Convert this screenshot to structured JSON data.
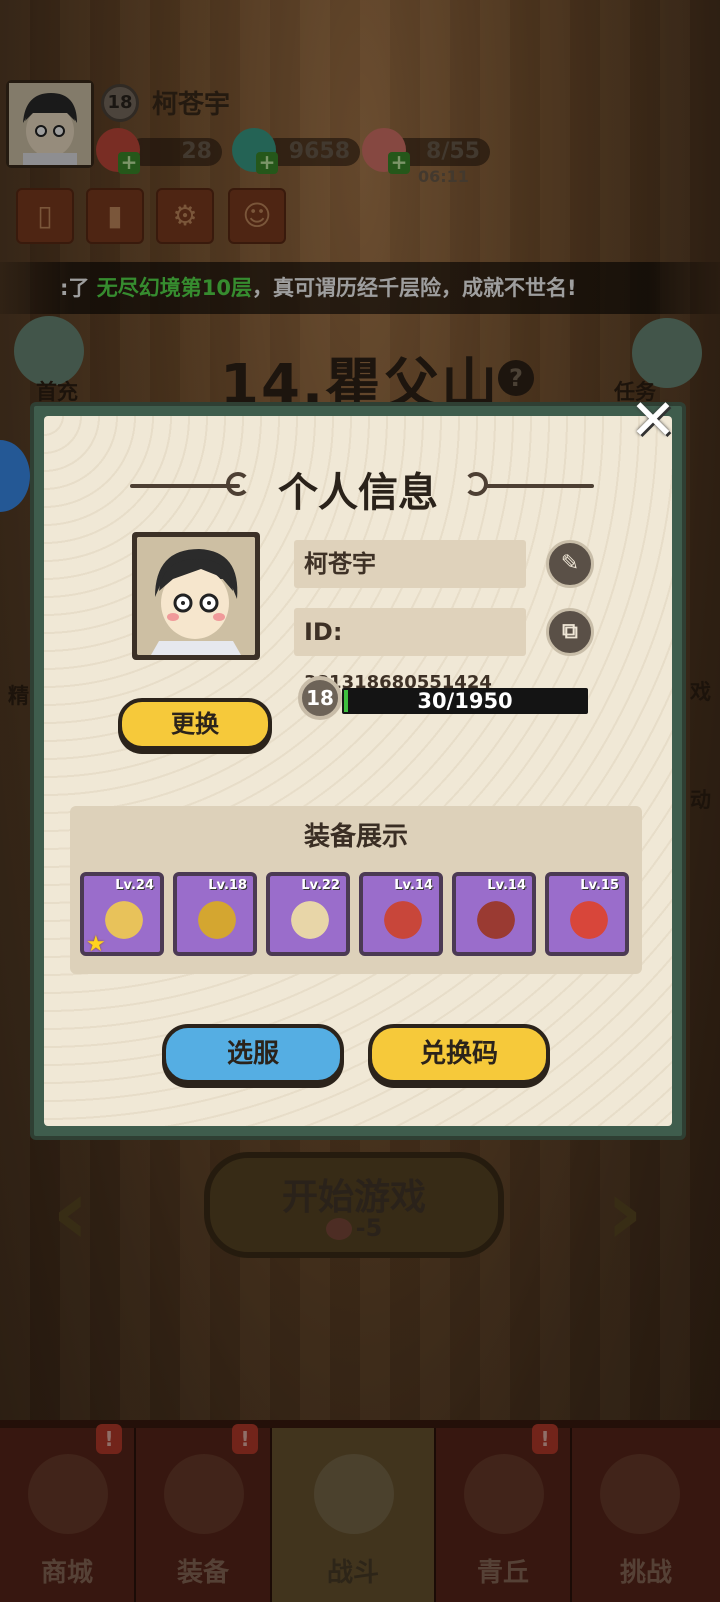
{
  "player": {
    "name": "柯苍宇",
    "level": "18"
  },
  "resources": {
    "gems": "28",
    "coins": "9658",
    "stamina": "8/55",
    "stamina_timer": "06:11"
  },
  "marquee": {
    "prefix": ":了 ",
    "highlight": "无尽幻境第10层",
    "suffix": "，真可谓历经千层险，成就不世名!"
  },
  "side": {
    "first_charge": "首充",
    "quest": "任务",
    "left_partial": "精",
    "right_partial_1": "戏",
    "right_partial_2": "动"
  },
  "stage": {
    "title": "14.瞿父山"
  },
  "modal": {
    "title": "个人信息",
    "name": "柯苍宇",
    "id_label": "ID:",
    "id_value": "381318680551424",
    "level": "18",
    "xp_text": "30/1950",
    "xp_fraction": 0.0154,
    "change_button": "更换",
    "equip_title": "装备展示",
    "equipment": [
      {
        "level": "Lv.24",
        "icon": "necklace-icon",
        "color": "#e8c25a",
        "starred": true
      },
      {
        "level": "Lv.18",
        "icon": "armor-icon",
        "color": "#d4a630",
        "starred": false
      },
      {
        "level": "Lv.22",
        "icon": "glove-icon",
        "color": "#e8d6a8",
        "starred": false
      },
      {
        "level": "Lv.14",
        "icon": "belt-icon",
        "color": "#c8463a",
        "starred": false
      },
      {
        "level": "Lv.14",
        "icon": "boots-icon",
        "color": "#9a3a32",
        "starred": false
      },
      {
        "level": "Lv.15",
        "icon": "orb-icon",
        "color": "#d8463a",
        "starred": false
      }
    ],
    "server_button": "选服",
    "redeem_button": "兑换码"
  },
  "start": {
    "label": "开始游戏",
    "cost": "-5"
  },
  "nav": [
    {
      "label": "商城",
      "icon": "shop-icon",
      "badge": "!"
    },
    {
      "label": "装备",
      "icon": "equipment-helmet-icon",
      "badge": "!"
    },
    {
      "label": "战斗",
      "icon": "crossed-swords-icon",
      "badge": ""
    },
    {
      "label": "青丘",
      "icon": "mountain-icon",
      "badge": "!"
    },
    {
      "label": "挑战",
      "icon": "challenge-orb-icon",
      "badge": ""
    }
  ]
}
